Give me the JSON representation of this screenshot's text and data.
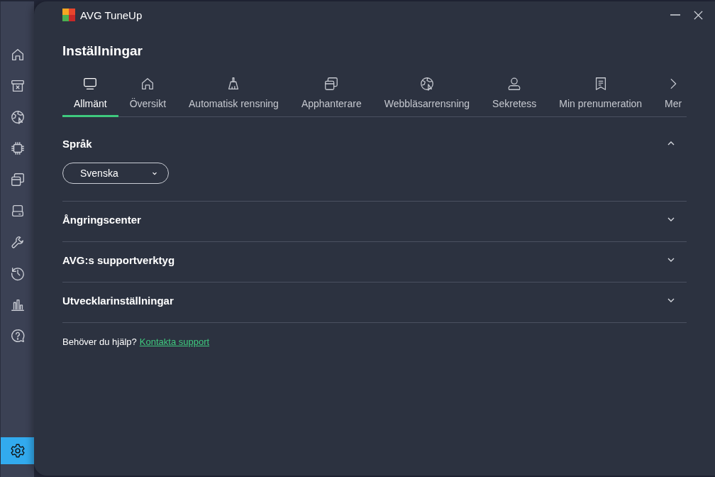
{
  "window": {
    "title": "AVG TuneUp"
  },
  "sidebar": {
    "items": [
      {
        "kind": "home",
        "selected": false
      },
      {
        "kind": "archive",
        "selected": false
      },
      {
        "kind": "globe",
        "selected": false
      },
      {
        "kind": "chip",
        "selected": false
      },
      {
        "kind": "windows",
        "selected": false
      },
      {
        "kind": "drive",
        "selected": false
      },
      {
        "kind": "wrench",
        "selected": false
      },
      {
        "kind": "history",
        "selected": false
      },
      {
        "kind": "chart",
        "selected": false
      },
      {
        "kind": "help",
        "selected": false
      }
    ],
    "bottom_item": {
      "kind": "settings",
      "selected": true
    }
  },
  "page_title": "Inställningar",
  "tabs": [
    {
      "kind": "monitor",
      "label": "Allmänt",
      "selected": true
    },
    {
      "kind": "home",
      "label": "Översikt",
      "selected": false
    },
    {
      "kind": "broom",
      "label": "Automatisk rensning",
      "selected": false
    },
    {
      "kind": "windows",
      "label": "Apphanterare",
      "selected": false
    },
    {
      "kind": "globe",
      "label": "Webbläsarrensning",
      "selected": false
    },
    {
      "kind": "person",
      "label": "Sekretess",
      "selected": false
    },
    {
      "kind": "receipt",
      "label": "Min prenumeration",
      "selected": false
    },
    {
      "kind": "more",
      "label": "Mer",
      "selected": false
    }
  ],
  "sections": [
    {
      "title": "Språk",
      "expanded": true,
      "dropdown": {
        "value": "Svenska"
      }
    },
    {
      "title": "Ångringscenter",
      "expanded": false
    },
    {
      "title": "AVG:s supportverktyg",
      "expanded": false
    },
    {
      "title": "Utvecklarinställningar",
      "expanded": false
    }
  ],
  "footer": {
    "text": "Behöver du hjälp?",
    "link": "Kontakta support"
  }
}
